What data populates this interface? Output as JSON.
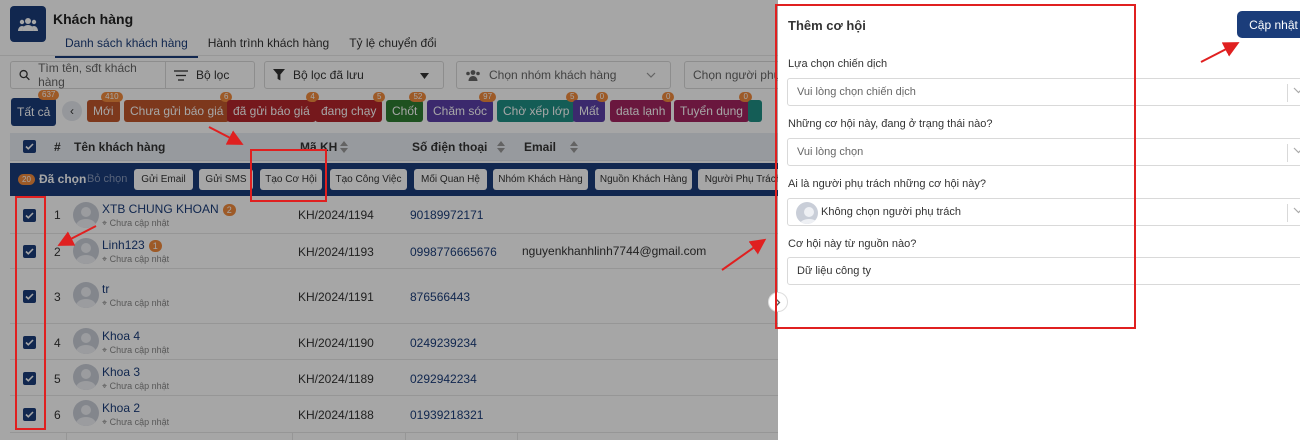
{
  "header": {
    "title": "Khách hàng",
    "tabs": [
      "Danh sách khách hàng",
      "Hành trình khách hàng",
      "Tỷ lệ chuyển đổi"
    ]
  },
  "filters": {
    "search_placeholder": "Tìm tên, sđt khách hàng",
    "filter_label": "Bộ lọc",
    "saved_filter_label": "Bộ lọc đã lưu",
    "group_placeholder": "Chọn nhóm khách hàng",
    "owner_placeholder": "Chọn người phụ tr"
  },
  "chips": [
    {
      "label": "Tất cả",
      "count": "637",
      "color": "#1b3d7a"
    },
    {
      "label": "‹",
      "count": "",
      "color": "#e5e8ee"
    },
    {
      "label": "Mới",
      "count": "410",
      "color": "#c0562b"
    },
    {
      "label": "Chưa gửi báo giá",
      "count": "6",
      "color": "#c0562b"
    },
    {
      "label": "đã gửi báo giá",
      "count": "4",
      "color": "#b4252c"
    },
    {
      "label": "đang chạy",
      "count": "5",
      "color": "#b4252c"
    },
    {
      "label": "Chốt",
      "count": "52",
      "color": "#2f7d32"
    },
    {
      "label": "Chăm sóc",
      "count": "97",
      "color": "#5b3fa8"
    },
    {
      "label": "Chờ xếp lớp",
      "count": "5",
      "color": "#1f8f84"
    },
    {
      "label": "Mất",
      "count": "0",
      "color": "#5b3fa8"
    },
    {
      "label": "data lạnh",
      "count": "0",
      "color": "#a32460"
    },
    {
      "label": "Tuyển dụng",
      "count": "0",
      "color": "#a32460"
    }
  ],
  "table": {
    "headers": [
      "#",
      "Tên khách hàng",
      "Mã KH",
      "Số điện thoại",
      "Email"
    ],
    "selected_count": "20",
    "selected_label": "Đã chọn",
    "deselect_label": "Bỏ chọn",
    "actions": [
      "Gửi Email",
      "Gửi SMS",
      "Tạo Cơ Hội",
      "Tạo Công Việc",
      "Mối Quan Hệ",
      "Nhóm Khách Hàng",
      "Nguồn Khách Hàng",
      "Người Phụ Trách"
    ],
    "rows": [
      {
        "idx": "1",
        "name": "XTB CHUNG KHOAN",
        "badge": "2",
        "sub": "Chưa cập nhật",
        "code": "KH/2024/1194",
        "phone": "90189972171",
        "email": ""
      },
      {
        "idx": "2",
        "name": "Linh123",
        "badge": "1",
        "sub": "Chưa cập nhật",
        "code": "KH/2024/1193",
        "phone": "0998776665676",
        "email": "nguyenkhanhlinh7744@gmail.com"
      },
      {
        "idx": "3",
        "name": "tr",
        "badge": "",
        "sub": "Chưa cập nhật",
        "code": "KH/2024/1191",
        "phone": "876566443",
        "email": ""
      },
      {
        "idx": "4",
        "name": "Khoa 4",
        "badge": "",
        "sub": "Chưa cập nhật",
        "code": "KH/2024/1190",
        "phone": "0249239234",
        "email": ""
      },
      {
        "idx": "5",
        "name": "Khoa 3",
        "badge": "",
        "sub": "Chưa cập nhật",
        "code": "KH/2024/1189",
        "phone": "0292942234",
        "email": ""
      },
      {
        "idx": "6",
        "name": "Khoa 2",
        "badge": "",
        "sub": "Chưa cập nhật",
        "code": "KH/2024/1188",
        "phone": "01939218321",
        "email": ""
      }
    ]
  },
  "panel": {
    "title": "Thêm cơ hội",
    "update_label": "Cập nhật",
    "fields": [
      {
        "label": "Lựa chọn chiến dịch",
        "value": "Vui lòng chọn chiến dịch"
      },
      {
        "label": "Những cơ hội này, đang ở trạng thái nào?",
        "value": "Vui lòng chọn"
      },
      {
        "label": "Ai là người phụ trách những cơ hội này?",
        "value": "Không chọn người phụ trách"
      },
      {
        "label": "Cơ hội này từ nguồn nào?",
        "value": "Dữ liệu công ty"
      }
    ]
  },
  "colors": {
    "primary": "#1b3d7a",
    "annotation": "#e02020"
  }
}
